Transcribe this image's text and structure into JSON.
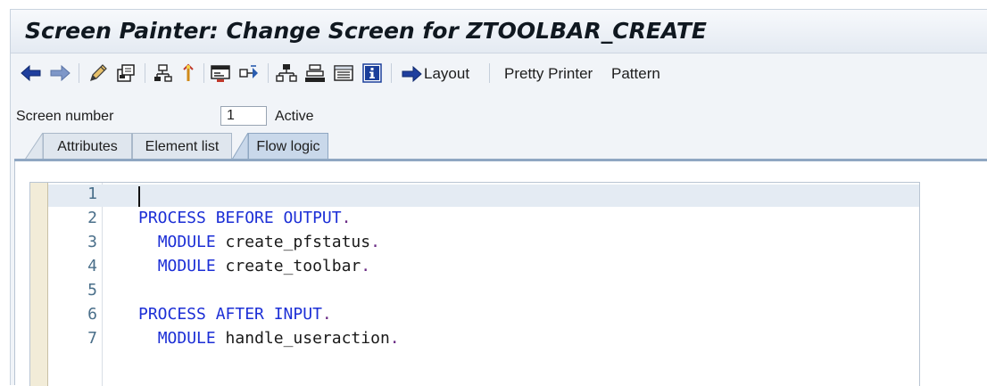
{
  "window": {
    "title": "Screen Painter: Change Screen for ZTOOLBAR_CREATE"
  },
  "toolbar": {
    "icons": [
      "back-arrow-icon",
      "forward-arrow-icon",
      "edit-pencil-icon",
      "display-change-icon",
      "hierarchy-icon",
      "where-used-icon",
      "screen-element-icon",
      "navigation-icon",
      "tree-icon",
      "stack-icon",
      "list-icon",
      "info-icon"
    ],
    "layout_label": "Layout",
    "pretty_printer_label": "Pretty Printer",
    "pattern_label": "Pattern"
  },
  "screen": {
    "number_label": "Screen number",
    "number_value": "1",
    "status": "Active"
  },
  "tabs": [
    {
      "label": "Attributes",
      "active": false
    },
    {
      "label": "Element list",
      "active": false
    },
    {
      "label": "Flow logic",
      "active": true
    }
  ],
  "editor": {
    "lines": [
      {
        "num": "1",
        "tokens": []
      },
      {
        "num": "2",
        "tokens": [
          {
            "t": "kw",
            "v": "PROCESS BEFORE OUTPUT"
          },
          {
            "t": "pt",
            "v": "."
          }
        ]
      },
      {
        "num": "3",
        "tokens": [
          {
            "t": "sp",
            "v": "  "
          },
          {
            "t": "kw",
            "v": "MODULE"
          },
          {
            "t": "id",
            "v": " create_pfstatus"
          },
          {
            "t": "pt",
            "v": "."
          }
        ]
      },
      {
        "num": "4",
        "tokens": [
          {
            "t": "sp",
            "v": "  "
          },
          {
            "t": "kw",
            "v": "MODULE"
          },
          {
            "t": "id",
            "v": " create_toolbar"
          },
          {
            "t": "pt",
            "v": "."
          }
        ]
      },
      {
        "num": "5",
        "tokens": []
      },
      {
        "num": "6",
        "tokens": [
          {
            "t": "kw",
            "v": "PROCESS AFTER INPUT"
          },
          {
            "t": "pt",
            "v": "."
          }
        ]
      },
      {
        "num": "7",
        "tokens": [
          {
            "t": "sp",
            "v": "  "
          },
          {
            "t": "kw",
            "v": "MODULE"
          },
          {
            "t": "id",
            "v": " handle_useraction"
          },
          {
            "t": "pt",
            "v": "."
          }
        ]
      }
    ]
  },
  "colors": {
    "keyword": "#1c2fd6",
    "identifier": "#1a1a1a",
    "punctuation": "#6a2a84",
    "line_number": "#4a6f8a",
    "current_line": "#e4ebf3"
  }
}
